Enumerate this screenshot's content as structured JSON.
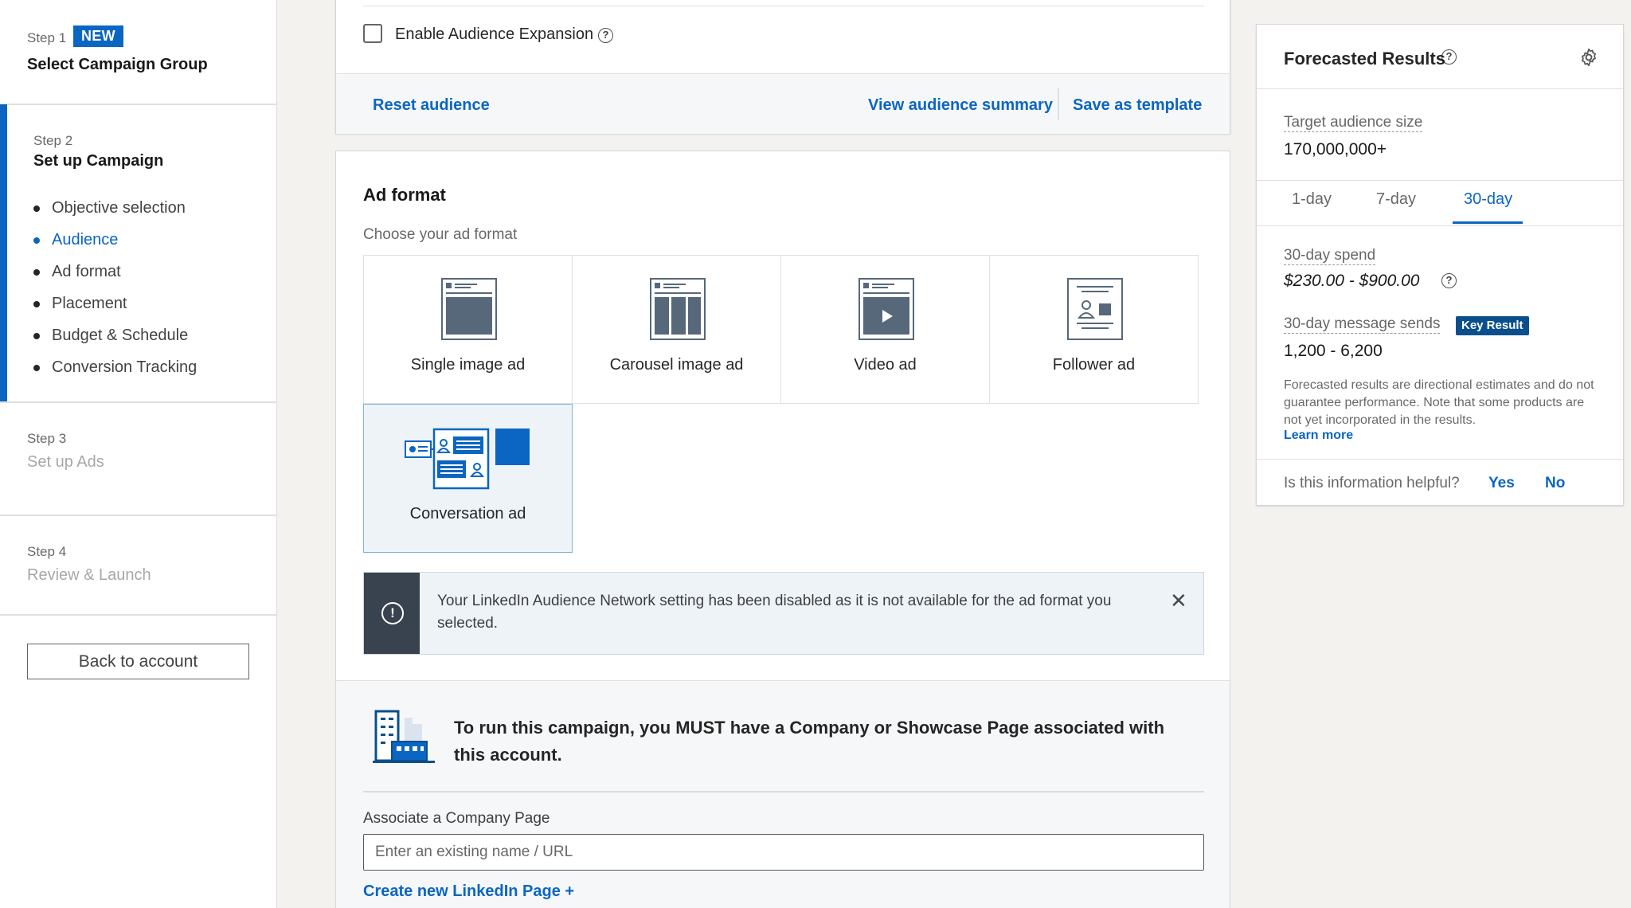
{
  "sidebar": {
    "step1": {
      "num": "Step 1",
      "badge": "NEW",
      "title": "Select Campaign Group"
    },
    "step2": {
      "num": "Step 2",
      "title": "Set up Campaign",
      "items": [
        {
          "label": "Objective selection"
        },
        {
          "label": "Audience"
        },
        {
          "label": "Ad format"
        },
        {
          "label": "Placement"
        },
        {
          "label": "Budget & Schedule"
        },
        {
          "label": "Conversion Tracking"
        }
      ]
    },
    "step3": {
      "num": "Step 3",
      "title": "Set up Ads"
    },
    "step4": {
      "num": "Step 4",
      "title": "Review & Launch"
    },
    "back_label": "Back to account"
  },
  "audience": {
    "expansion_label": "Enable Audience Expansion",
    "reset_label": "Reset audience",
    "summary_label": "View audience summary",
    "template_label": "Save as template"
  },
  "ad_format": {
    "title": "Ad format",
    "subtitle": "Choose your ad format",
    "formats": [
      {
        "label": "Single image ad"
      },
      {
        "label": "Carousel image ad"
      },
      {
        "label": "Video ad"
      },
      {
        "label": "Follower ad"
      },
      {
        "label": "Conversation ad"
      }
    ],
    "alert_text": "Your LinkedIn Audience Network setting has been disabled as it is not available for the ad format you selected."
  },
  "company": {
    "message": "To run this campaign, you MUST have a Company or Showcase Page associated with this account.",
    "assoc_label": "Associate a Company Page",
    "input_placeholder": "Enter an existing name / URL",
    "create_label": "Create new LinkedIn Page +"
  },
  "forecast": {
    "title": "Forecasted Results",
    "audience_label": "Target audience size",
    "audience_value": "170,000,000+",
    "tabs": [
      {
        "label": "1-day"
      },
      {
        "label": "7-day"
      },
      {
        "label": "30-day"
      }
    ],
    "active_tab": "30-day",
    "spend_label": "30-day spend",
    "spend_value": "$230.00 - $900.00",
    "sends_label": "30-day message sends",
    "key_badge": "Key Result",
    "sends_value": "1,200 - 6,200",
    "disclaimer": "Forecasted results are directional estimates and do not guarantee performance. Note that some products are not yet incorporated in the results.",
    "learn_more": "Learn more",
    "helpful_q": "Is this information helpful?",
    "yes": "Yes",
    "no": "No"
  },
  "colors": {
    "accent": "#0a66c2",
    "alert_side": "#38434f",
    "background": "#f3f2ef"
  }
}
